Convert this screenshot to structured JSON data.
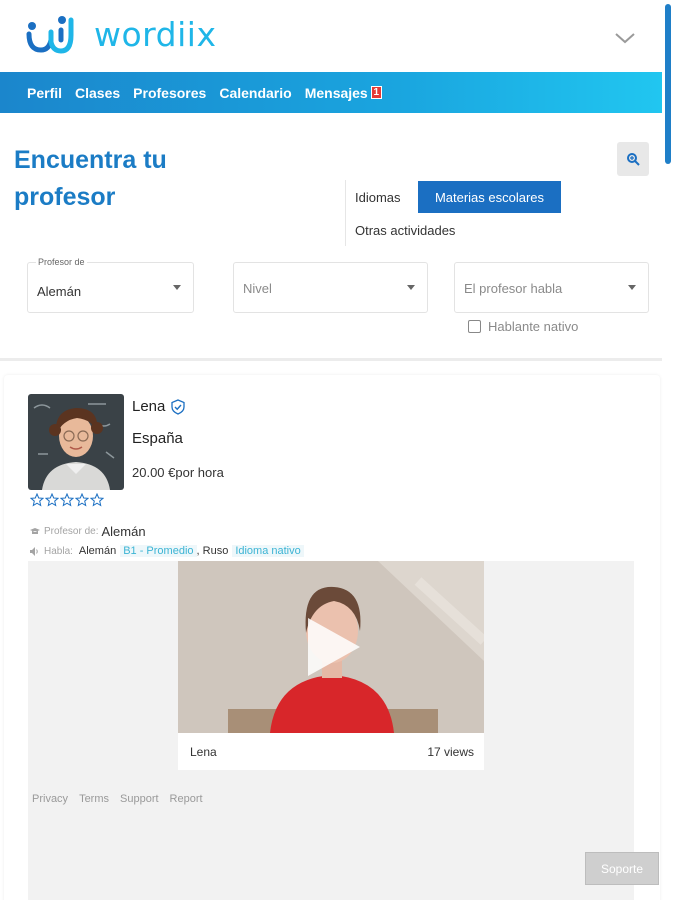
{
  "brand": {
    "name": "wordiix",
    "color": "#1fb6e8"
  },
  "nav": {
    "items": [
      {
        "label": "Perfil"
      },
      {
        "label": "Clases"
      },
      {
        "label": "Profesores"
      },
      {
        "label": "Calendario"
      },
      {
        "label": "Mensajes",
        "badge": "1"
      }
    ]
  },
  "page": {
    "title": "Encuentra tu profesor"
  },
  "tabs": {
    "idiomas": "Idiomas",
    "materias": "Materias escolares",
    "otras": "Otras actividades",
    "active_color": "#1b6fc2"
  },
  "filters": {
    "teacher_of": {
      "legend": "Profesor de",
      "value": "Alemán"
    },
    "level": {
      "placeholder": "Nivel"
    },
    "speaks": {
      "placeholder": "El profesor habla"
    },
    "native_label": "Hablante nativo"
  },
  "teacher": {
    "name": "Lena",
    "country": "España",
    "price": "20.00 €por hora",
    "rating": 0,
    "teaches_label": "Profesor de:",
    "teaches_value": "Alemán",
    "speaks_label": "Habla:",
    "languages": [
      {
        "name": "Alemán",
        "level": "B1 - Promedio"
      },
      {
        "name": ", Ruso",
        "level": "Idioma nativo"
      }
    ]
  },
  "video": {
    "title": "Lena",
    "views": "17 views"
  },
  "footer": {
    "links": [
      "Privacy",
      "Terms",
      "Support",
      "Report"
    ],
    "support_button": "Soporte"
  },
  "icons": {
    "search": "search-icon",
    "chevron": "chevron-down-icon",
    "verified": "verified-check-icon",
    "star": "star-outline-icon",
    "play": "play-icon"
  }
}
